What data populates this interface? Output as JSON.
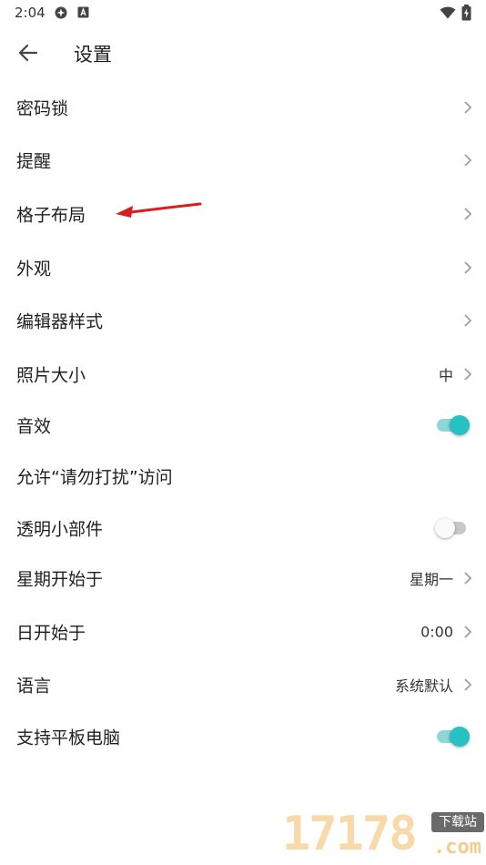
{
  "status_bar": {
    "time": "2:04",
    "icons": [
      "settings-cog-icon",
      "a-box-icon",
      "wifi-icon",
      "battery-charging-icon"
    ]
  },
  "header": {
    "back_icon": "arrow-left-icon",
    "title": "设置"
  },
  "settings": [
    {
      "label": "密码锁",
      "control": "chevron"
    },
    {
      "label": "提醒",
      "control": "chevron"
    },
    {
      "label": "格子布局",
      "control": "chevron"
    },
    {
      "label": "外观",
      "control": "chevron"
    },
    {
      "label": "编辑器样式",
      "control": "chevron"
    },
    {
      "label": "照片大小",
      "value": "中",
      "control": "chevron"
    },
    {
      "label": "音效",
      "control": "toggle",
      "toggled": true
    },
    {
      "label": "允许“请勿打扰”访问",
      "control": "none"
    },
    {
      "label": "透明小部件",
      "control": "toggle",
      "toggled": false
    },
    {
      "label": "星期开始于",
      "value": "星期一",
      "control": "chevron"
    },
    {
      "label": "日开始于",
      "value": "0:00",
      "control": "chevron"
    },
    {
      "label": "语言",
      "value": "系统默认",
      "control": "chevron"
    },
    {
      "label": "支持平板电脑",
      "control": "toggle",
      "toggled": true
    }
  ],
  "colors": {
    "accent": "#26c1c3",
    "accent_track": "#8ed7d8",
    "annotation_arrow": "#d81e1e"
  },
  "watermark": {
    "digits": "17178",
    "badge": "下载站",
    "suffix": ".com"
  }
}
